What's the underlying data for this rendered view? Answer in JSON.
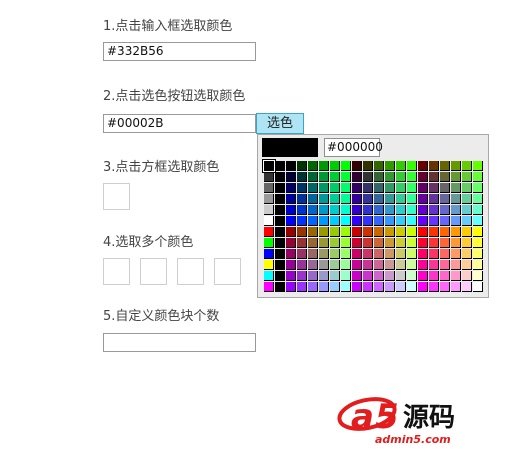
{
  "steps": [
    {
      "label": "1.点击输入框选取颜色",
      "value": "#332B56"
    },
    {
      "label": "2.点击选色按钮选取颜色",
      "value": "#00002B",
      "button": "选色"
    },
    {
      "label": "3.点击方框选取颜色"
    },
    {
      "label": "4.选取多个颜色"
    },
    {
      "label": "5.自定义颜色块个数",
      "value": ""
    }
  ],
  "palette": {
    "preview_color": "#000000",
    "hex_value": "#000000"
  },
  "watermark": {
    "logo_text": "a5源码",
    "site": "admin5.com"
  }
}
